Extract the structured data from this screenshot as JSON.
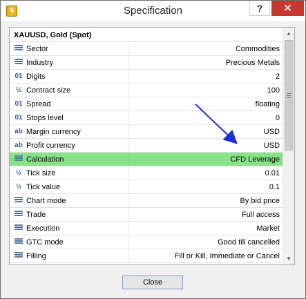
{
  "window": {
    "title": "Specification",
    "help_label": "?",
    "close_label": "✕"
  },
  "symbol_header": "XAUUSD, Gold (Spot)",
  "rows": [
    {
      "icon": "lines-icon",
      "label": "Sector",
      "value": "Commodities"
    },
    {
      "icon": "lines-icon",
      "label": "Industry",
      "value": "Precious Metals"
    },
    {
      "icon": "number-icon",
      "label": "Digits",
      "value": "2"
    },
    {
      "icon": "fraction-icon",
      "label": "Contract size",
      "value": "100"
    },
    {
      "icon": "number-icon",
      "label": "Spread",
      "value": "floating"
    },
    {
      "icon": "number-icon",
      "label": "Stops level",
      "value": "0"
    },
    {
      "icon": "text-icon",
      "label": "Margin currency",
      "value": "USD"
    },
    {
      "icon": "text-icon",
      "label": "Profit currency",
      "value": "USD"
    },
    {
      "icon": "lines-icon",
      "label": "Calculation",
      "value": "CFD Leverage"
    },
    {
      "icon": "fraction-icon",
      "label": "Tick size",
      "value": "0.01"
    },
    {
      "icon": "fraction-icon",
      "label": "Tick value",
      "value": "0.1"
    },
    {
      "icon": "lines-icon",
      "label": "Chart mode",
      "value": "By bid price"
    },
    {
      "icon": "lines-icon",
      "label": "Trade",
      "value": "Full access"
    },
    {
      "icon": "lines-icon",
      "label": "Execution",
      "value": "Market"
    },
    {
      "icon": "lines-icon",
      "label": "GTC mode",
      "value": "Good till cancelled"
    },
    {
      "icon": "lines-icon",
      "label": "Filling",
      "value": "Fill or Kill, Immediate or Cancel"
    }
  ],
  "highlight_row": "Calculation",
  "icon_glyphs": {
    "number": "01",
    "fraction": "½",
    "text": "ab"
  },
  "colors": {
    "highlight": "#88e388",
    "arrow": "#1f2fd6",
    "close_button": "#c7392f"
  },
  "close_button_label": "Close"
}
